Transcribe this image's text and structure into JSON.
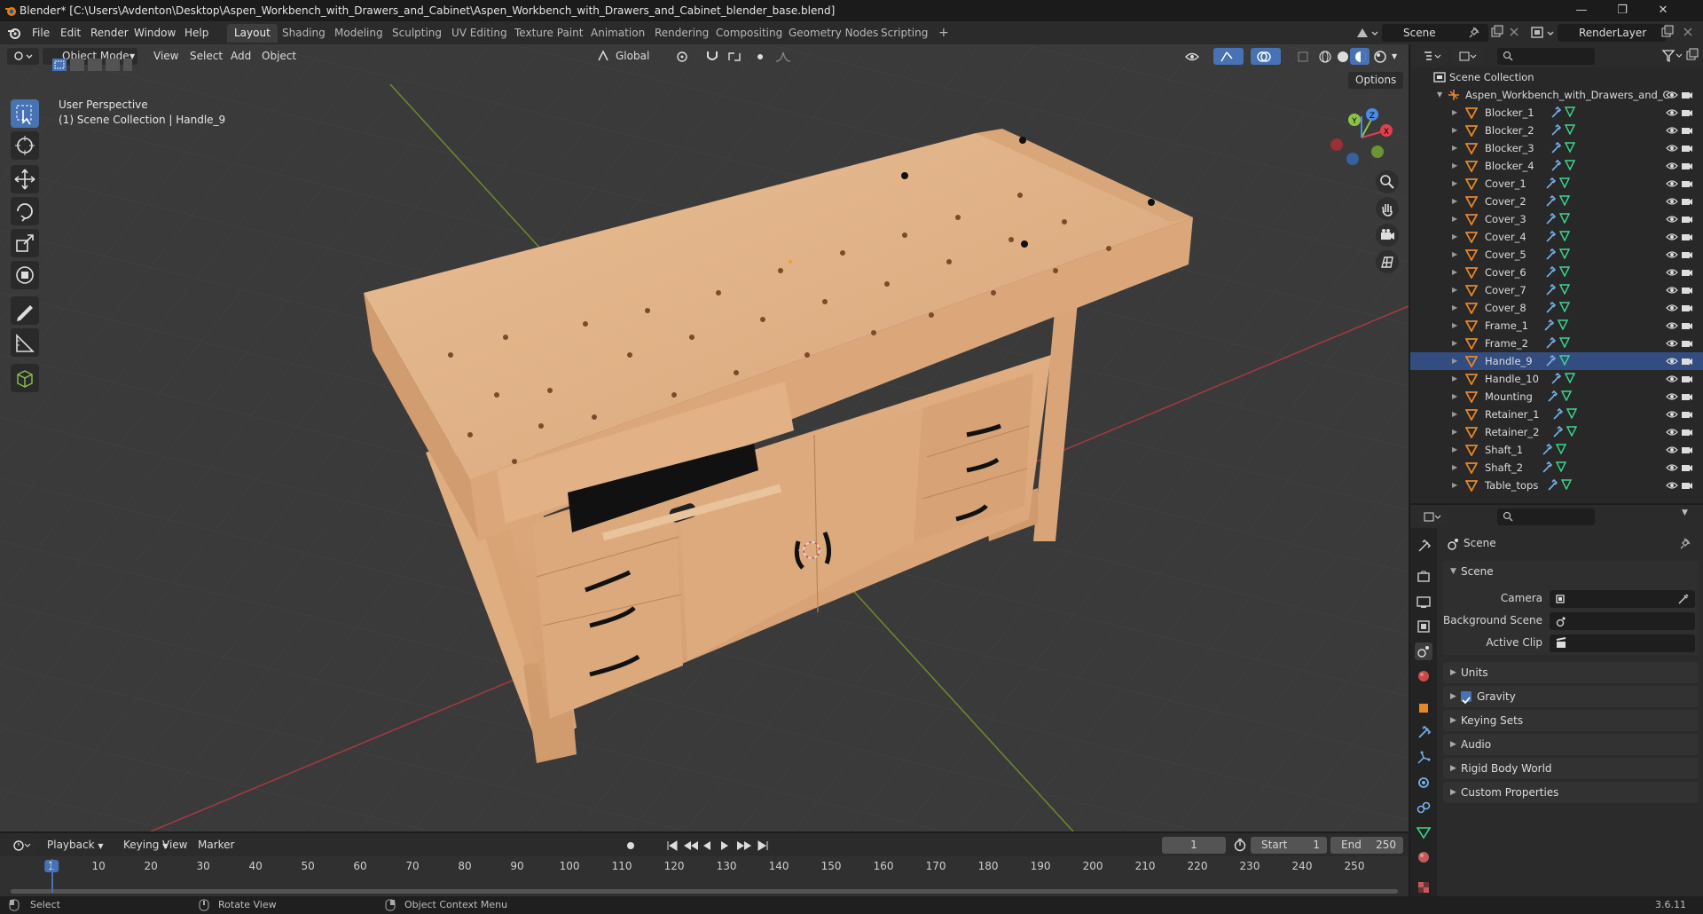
{
  "window": {
    "title": "Blender* [C:\\Users\\Avdenton\\Desktop\\Aspen_Workbench_with_Drawers_and_Cabinet\\Aspen_Workbench_with_Drawers_and_Cabinet_blender_base.blend]",
    "minimize": "—",
    "maximize": "❐",
    "close": "✕"
  },
  "menu": [
    "File",
    "Edit",
    "Render",
    "Window",
    "Help"
  ],
  "workspaces": [
    "Layout",
    "Shading",
    "Modeling",
    "Sculpting",
    "UV Editing",
    "Texture Paint",
    "Animation",
    "Rendering",
    "Compositing",
    "Geometry Nodes",
    "Scripting"
  ],
  "workspace_add": "+",
  "scene_field": "Scene",
  "renderlayer_field": "RenderLayer",
  "viewport": {
    "mode": "Object Mode",
    "menus": [
      "View",
      "Select",
      "Add",
      "Object"
    ],
    "transform_orientation": "Global",
    "options": "Options",
    "perspective": "User Perspective",
    "collection_info": "(1) Scene Collection | Handle_9",
    "gizmo_axes": {
      "x": "X",
      "y": "Y",
      "z": "Z"
    }
  },
  "outliner": {
    "root": "Scene Collection",
    "collection": "Aspen_Workbench_with_Drawers_and_C",
    "objects": [
      "Blocker_1",
      "Blocker_2",
      "Blocker_3",
      "Blocker_4",
      "Cover_1",
      "Cover_2",
      "Cover_3",
      "Cover_4",
      "Cover_5",
      "Cover_6",
      "Cover_7",
      "Cover_8",
      "Frame_1",
      "Frame_2",
      "Handle_9",
      "Handle_10",
      "Mounting",
      "Retainer_1",
      "Retainer_2",
      "Shaft_1",
      "Shaft_2",
      "Table_tops"
    ],
    "selected": "Handle_9"
  },
  "properties": {
    "context_title": "Scene",
    "section": "Scene",
    "camera_label": "Camera",
    "background_label": "Background Scene",
    "clip_label": "Active Clip",
    "panels": [
      "Units",
      "Gravity",
      "Keying Sets",
      "Audio",
      "Rigid Body World",
      "Custom Properties"
    ],
    "gravity_checked": true
  },
  "timeline": {
    "menus": [
      "Playback",
      "Keying",
      "View",
      "Marker"
    ],
    "current_frame": "1",
    "start_label": "Start",
    "start": "1",
    "end_label": "End",
    "end": "250",
    "ticks": [
      "1",
      "10",
      "20",
      "30",
      "40",
      "50",
      "60",
      "70",
      "80",
      "90",
      "100",
      "110",
      "120",
      "130",
      "140",
      "150",
      "160",
      "170",
      "180",
      "190",
      "200",
      "210",
      "220",
      "230",
      "240",
      "250"
    ]
  },
  "status": {
    "select": "Select",
    "rotate": "Rotate View",
    "context": "Object Context Menu",
    "version": "3.6.11"
  },
  "colors": {
    "accent": "#4772b3",
    "wood": "#e2b388",
    "object_icon": "#e8862a",
    "mesh_icon": "#3dd68c",
    "modifier_icon": "#75b0e8",
    "x_axis": "#e2404d",
    "y_axis": "#8bc34a",
    "z_axis": "#4a8de8"
  }
}
